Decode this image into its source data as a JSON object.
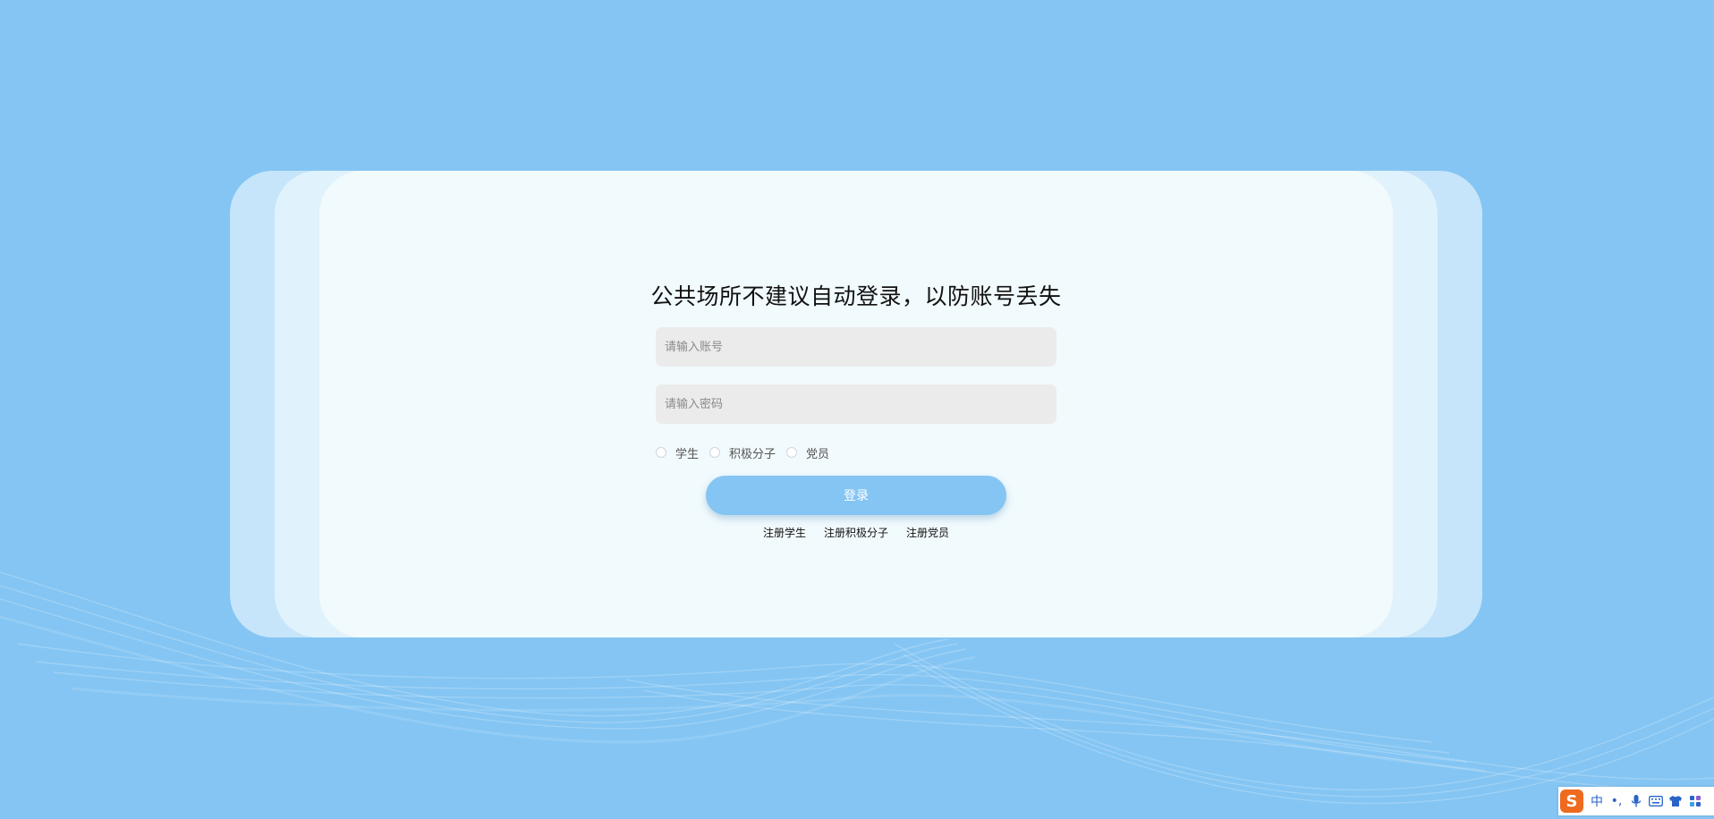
{
  "login": {
    "title": "公共场所不建议自动登录，以防账号丢失",
    "account_placeholder": "请输入账号",
    "password_placeholder": "请输入密码",
    "roles": [
      "学生",
      "积极分子",
      "党员"
    ],
    "submit_label": "登录",
    "register_links": [
      "注册学生",
      "注册积极分子",
      "注册党员"
    ]
  },
  "ime_toolbar": {
    "logo": "S",
    "mode": "中",
    "punctuation": "•,",
    "icons": [
      "microphone-icon",
      "keyboard-icon",
      "skin-icon",
      "toolbox-icon"
    ]
  },
  "colors": {
    "background": "#84c5f3",
    "card": "#f1fafd",
    "button": "#84c5f3",
    "input": "#ebebeb",
    "ime_logo": "#ee6a1e"
  }
}
